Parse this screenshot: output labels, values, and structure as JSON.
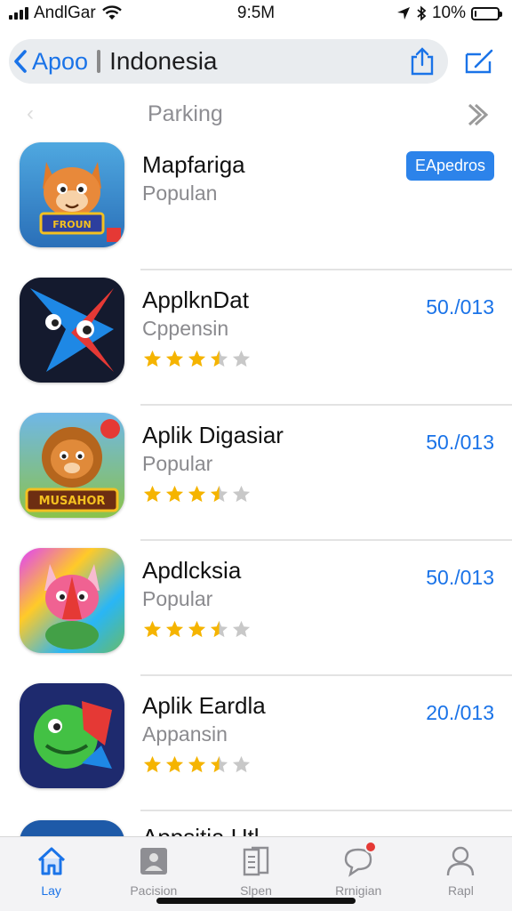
{
  "status": {
    "carrier": "AndlGar",
    "time": "9:5M",
    "battery": "10%",
    "battery_level": 0.1
  },
  "nav": {
    "back_label": "Apoo",
    "title": "Indonesia"
  },
  "section": {
    "title": "Parking"
  },
  "apps": [
    {
      "name": "Mapfariga",
      "category": "Populan",
      "action": "EApedros",
      "action_style": "pill",
      "rating": null,
      "icon_theme": "fox-orange"
    },
    {
      "name": "ApplknDat",
      "category": "Cppensin",
      "action": "50./013",
      "action_style": "text",
      "rating": 3.5,
      "icon_theme": "arrow-dark"
    },
    {
      "name": "Aplik Digasiar",
      "category": "Popular",
      "action": "50./013",
      "action_style": "text",
      "rating": 3.5,
      "icon_theme": "lion-brown"
    },
    {
      "name": "Apdlcksia",
      "category": "Popular",
      "action": "50./013",
      "action_style": "text",
      "rating": 3.5,
      "icon_theme": "cat-rainbow"
    },
    {
      "name": "Aplik Eardla",
      "category": "Appansin",
      "action": "20./013",
      "action_style": "text",
      "rating": 3.5,
      "icon_theme": "bird-green"
    }
  ],
  "partial_app": {
    "name": "Appsitia Utl"
  },
  "icon_texts": {
    "fox_banner": "FROUN",
    "lion_banner": "MUSAHOR"
  },
  "tabs": [
    {
      "label": "Lay",
      "icon": "home-icon",
      "active": true
    },
    {
      "label": "Pacision",
      "icon": "profile-card-icon",
      "active": false
    },
    {
      "label": "Slpen",
      "icon": "book-icon",
      "active": false
    },
    {
      "label": "Rrnigian",
      "icon": "chat-bubble-icon",
      "active": false,
      "badge": true
    },
    {
      "label": "Rapl",
      "icon": "person-icon",
      "active": false
    }
  ],
  "colors": {
    "accent": "#1a73e8",
    "star": "#f5b400",
    "star_empty": "#c8c8c8",
    "badge": "#e53935"
  }
}
